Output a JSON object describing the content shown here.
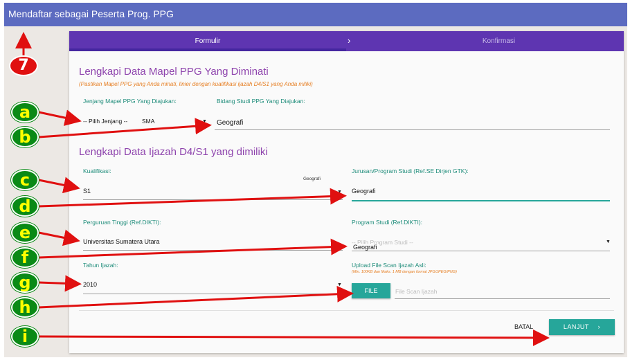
{
  "window": {
    "title": "Mendaftar sebagai Peserta Prog. PPG"
  },
  "tabs": {
    "active": "Formulir",
    "separator": "›",
    "next": "Konfirmasi"
  },
  "section1": {
    "heading": "Lengkapi Data Mapel PPG Yang Diminati",
    "note": "(Pastikan Mapel PPG yang Anda minati, linier dengan kualifikasi ijazah D4/S1 yang Anda miliki)",
    "jenjang_label": "Jenjang Mapel PPG Yang Diajukan:",
    "jenjang_placeholder": "-- Pilih Jenjang --",
    "jenjang_value": "SMA",
    "bidang_label": "Bidang Studi PPG Yang Diajukan:",
    "bidang_value": "Geografi"
  },
  "section2": {
    "heading": "Lengkapi Data Ijazah D4/S1 yang dimiliki",
    "kualifikasi_label": "Kualifikasi:",
    "kualifikasi_value": "S1",
    "kualifikasi_tooltip": "Geografi",
    "jurusan_label": "Jurusan/Program Studi (Ref.SE Dirjen GTK):",
    "jurusan_value": "Geografi",
    "pt_label": "Perguruan Tinggi (Ref.DIKTI):",
    "pt_value": "Universitas Sumatera Utara",
    "prodi_label": "Program Studi (Ref.DIKTI):",
    "prodi_placeholder": "-- Pilih Program Studi --",
    "prodi_value": "Geografi",
    "tahun_label": "Tahun Ijazah:",
    "tahun_value": "2010",
    "upload_label": "Upload File Scan Ijazah Asli:",
    "upload_note": "(Min. 100KB dan Maks. 1 MB dengan format JPG/JPEG/PNG)",
    "file_button": "FILE",
    "file_placeholder": "File Scan Ijazah"
  },
  "actions": {
    "batal": "BATAL",
    "lanjut": "LANJUT",
    "lanjut_icon": "chevron-right-icon"
  },
  "annotations": {
    "labels": [
      "7",
      "a",
      "b",
      "c",
      "d",
      "e",
      "f",
      "g",
      "h",
      "i"
    ],
    "badge_color": "#0a8a16",
    "badge_text_color": "#ffff00",
    "arrow_color": "#e01010"
  },
  "colors": {
    "header": "#5c6bc0",
    "tabbar": "#5e35b1",
    "accent": "#26a69a",
    "heading": "#8e44ad",
    "note": "#e67e22"
  }
}
